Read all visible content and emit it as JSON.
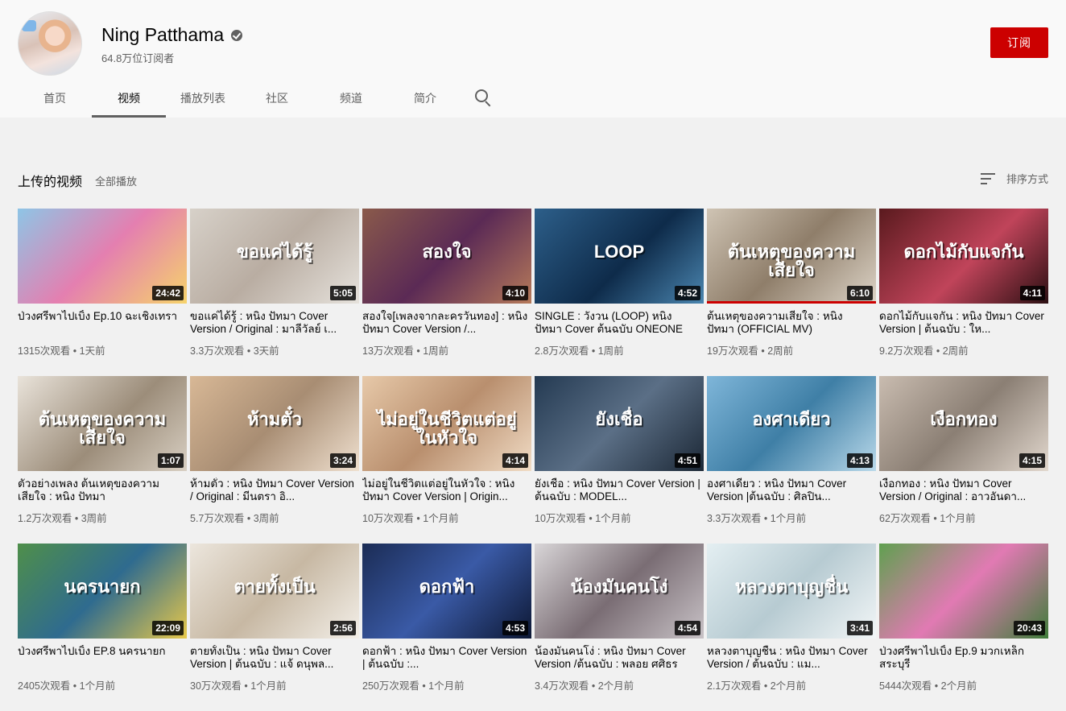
{
  "channel": {
    "name": "Ning Patthama",
    "subscribers": "64.8万位订阅者",
    "subscribe_label": "订阅"
  },
  "tabs": [
    {
      "label": "首页"
    },
    {
      "label": "视频"
    },
    {
      "label": "播放列表"
    },
    {
      "label": "社区"
    },
    {
      "label": "频道"
    },
    {
      "label": "简介"
    }
  ],
  "active_tab": "视频",
  "section": {
    "title": "上传的视频",
    "play_all": "全部播放",
    "sort_label": "排序方式"
  },
  "colors": {
    "accent": "#cc0000",
    "text": "#030303",
    "secondary": "#606060"
  },
  "videos": [
    {
      "title": "ป่วงศรีพาไปเบิ้ง Ep.10 ฉะเชิงเทรา",
      "duration": "24:42",
      "meta": "1315次观看 • 1天前",
      "overlay": "",
      "bg": "linear-gradient(135deg,#8ec5e6,#e47fb0 50%,#f6d36b)"
    },
    {
      "title": "ขอแค่ได้รู้ : หนิง ปัทมา Cover Version / Original : มาลีวัลย์ เ...",
      "duration": "5:05",
      "meta": "3.3万次观看 • 3天前",
      "overlay": "ขอแค่ได้รู้",
      "bg": "linear-gradient(135deg,#d7d1c9,#b9ada2 50%,#e6e2dc)"
    },
    {
      "title": "สองใจ[เพลงจากละครวันทอง] : หนิง ปัทมา Cover Version /...",
      "duration": "4:10",
      "meta": "13万次观看 • 1周前",
      "overlay": "สองใจ",
      "bg": "linear-gradient(135deg,#8a5a4b,#5b2a55 50%,#b67a5a)"
    },
    {
      "title": "SINGLE : วังวน (LOOP) หนิง ปัทมา Cover ต้นฉบับ ONEONE",
      "duration": "4:52",
      "meta": "2.8万次观看 • 1周前",
      "overlay": "LOOP",
      "bg": "linear-gradient(135deg,#2d5f8a,#0e2b4a 55%,#4b86b0)"
    },
    {
      "title": "ต้นเหตุของความเสียใจ : หนิง ปัทมา (OFFICIAL MV)",
      "duration": "6:10",
      "meta": "19万次观看 • 2周前",
      "overlay": "ต้นเหตุของความเสียใจ",
      "bg": "linear-gradient(135deg,#cfc4b4,#8f7e6a 50%,#dcd3c6)",
      "progress": 100
    },
    {
      "title": "ดอกไม้กับแจกัน : หนิง ปัทมา Cover Version | ต้นฉบับ : ให...",
      "duration": "4:11",
      "meta": "9.2万次观看 • 2周前",
      "overlay": "ดอกไม้กับแจกัน",
      "bg": "linear-gradient(135deg,#5a1a1e,#c0445a 55%,#2b0f12)"
    },
    {
      "title": "ตัวอย่างเพลง ต้นเหตุของความเสียใจ : หนิง ปัทมา",
      "duration": "1:07",
      "meta": "1.2万次观看 • 3周前",
      "overlay": "ต้นเหตุของความเสียใจ",
      "bg": "linear-gradient(135deg,#e9e3da,#9c8d7a 55%,#d8cfc2)"
    },
    {
      "title": "ห้ามตั๋ว : หนิง ปัทมา Cover Version / Original : มีนตรา อิ...",
      "duration": "3:24",
      "meta": "5.7万次观看 • 3周前",
      "overlay": "ห้ามตั๋ว",
      "bg": "linear-gradient(135deg,#d8b896,#a88d73 50%,#efe0cf)"
    },
    {
      "title": "ไม่อยู่ในชีวิตแต่อยู่ในหัวใจ : หนิง ปัทมา Cover Version | Origin...",
      "duration": "4:14",
      "meta": "10万次观看 • 1个月前",
      "overlay": "ไม่อยู่ในชีวิตแต่อยู่ในหัวใจ",
      "bg": "linear-gradient(135deg,#e7c9a9,#b98f6e 50%,#f1dcc5)"
    },
    {
      "title": "ยังเชื่อ : หนิง ปัทมา Cover Version | ต้นฉบับ : MODEL...",
      "duration": "4:51",
      "meta": "10万次观看 • 1个月前",
      "overlay": "ยังเชื่อ",
      "bg": "linear-gradient(135deg,#243a52,#5b6f86 50%,#1c2836)"
    },
    {
      "title": "องศาเดียว : หนิง ปัทมา Cover Version |ต้นฉบับ : ศิลปิน...",
      "duration": "4:13",
      "meta": "3.3万次观看 • 1个月前",
      "overlay": "องศาเดียว",
      "bg": "linear-gradient(135deg,#7fb6d9,#3f7fa6 50%,#b9d9ea)"
    },
    {
      "title": "เงือกทอง : หนิง ปัทมา Cover Version / Original : อาวอันดา...",
      "duration": "4:15",
      "meta": "62万次观看 • 1个月前",
      "overlay": "เงือกทอง",
      "bg": "linear-gradient(135deg,#c9bcb0,#8b7f74 50%,#e2d8ce)"
    },
    {
      "title": "ป่วงศรีพาไปเบิ้ง EP.8 นครนายก",
      "duration": "22:09",
      "meta": "2405次观看 • 1个月前",
      "overlay": "นครนายก",
      "bg": "linear-gradient(135deg,#4f8f4a,#2f6b8f 50%,#e7c84a)"
    },
    {
      "title": "ตายทั้งเป็น : หนิง ปัทมา Cover Version | ต้นฉบับ : แจ้ ดนุพล...",
      "duration": "2:56",
      "meta": "30万次观看 • 1个月前",
      "overlay": "ตายทั้งเป็น",
      "bg": "linear-gradient(135deg,#ece6dd,#c7b8a3 50%,#f3efe8)"
    },
    {
      "title": "ดอกฟ้า : หนิง ปัทมา Cover Version | ต้นฉบับ :...",
      "duration": "4:53",
      "meta": "250万次观看 • 1个月前",
      "overlay": "ดอกฟ้า",
      "bg": "linear-gradient(135deg,#1b2c55,#3a5aa6 50%,#0d1834)"
    },
    {
      "title": "น้องมันคนโง่ : หนิง ปัทมา Cover Version /ต้นฉบับ : พลอย ศศิธร",
      "duration": "4:54",
      "meta": "3.4万次观看 • 2个月前",
      "overlay": "น้องมันคนโง่",
      "bg": "linear-gradient(135deg,#d9d6d8,#7a6d74 50%,#c8c2c6)"
    },
    {
      "title": "หลวงตาบุญชื่น : หนิง ปัทมา Cover Version / ต้นฉบับ : แม...",
      "duration": "3:41",
      "meta": "2.1万次观看 • 2个月前",
      "overlay": "หลวงตาบุญชื่น",
      "bg": "linear-gradient(135deg,#e4eff2,#b7cbd2 50%,#f2f6f7)"
    },
    {
      "title": "ป่วงศรีพาไปเบิ้ง Ep.9 มวกเหล็ก สระบุรี",
      "duration": "20:43",
      "meta": "5444次观看 • 2个月前",
      "overlay": "",
      "bg": "linear-gradient(135deg,#5fa04f,#e17ab3 50%,#3e7d3a)"
    }
  ]
}
